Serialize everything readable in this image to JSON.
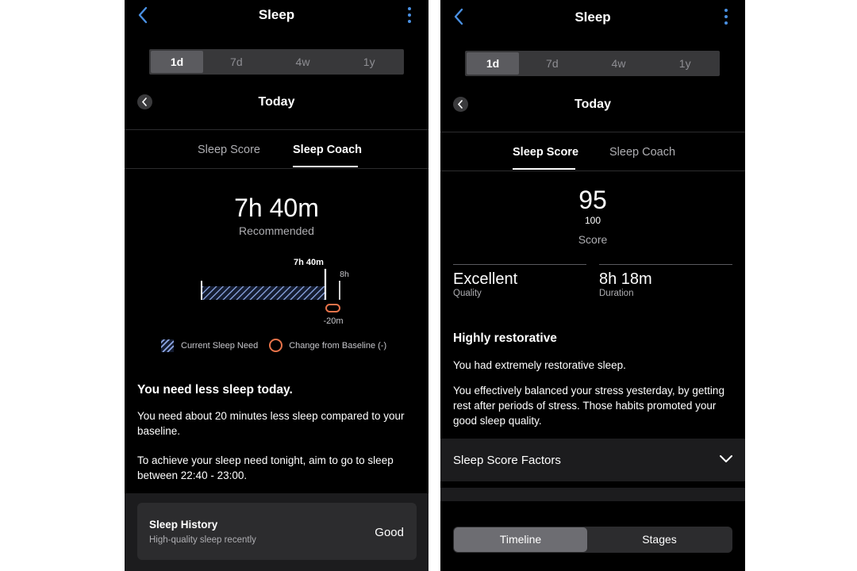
{
  "left": {
    "title": "Sleep",
    "ranges": [
      "1d",
      "7d",
      "4w",
      "1y"
    ],
    "date": "Today",
    "tabs": [
      "Sleep Score",
      "Sleep Coach"
    ],
    "recommended_value": "7h 40m",
    "recommended_label": "Recommended",
    "bar": {
      "need_label": "7h 40m",
      "baseline_label": "8h",
      "change_label": "-20m",
      "need_minutes": 460,
      "baseline_minutes": 480
    },
    "legend": {
      "need": "Current Sleep Need",
      "change": "Change from Baseline (-)"
    },
    "headline": "You need less sleep today.",
    "para1": "You need about 20 minutes less sleep compared to your baseline.",
    "para2": "To achieve your sleep need tonight, aim to go to sleep between 22:40 - 23:00.",
    "history": {
      "title": "Sleep History",
      "subtitle": "High-quality sleep recently",
      "value": "Good"
    }
  },
  "right": {
    "title": "Sleep",
    "ranges": [
      "1d",
      "7d",
      "4w",
      "1y"
    ],
    "date": "Today",
    "tabs": [
      "Sleep Score",
      "Sleep Coach"
    ],
    "score": "95",
    "score_max": "100",
    "score_label": "Score",
    "quality_value": "Excellent",
    "quality_label": "Quality",
    "duration_value": "8h 18m",
    "duration_label": "Duration",
    "headline": "Highly restorative",
    "para1": "You had extremely restorative sleep.",
    "para2": "You effectively balanced your stress yesterday, by getting rest after periods of stress. Those habits promoted your good sleep quality.",
    "factors_label": "Sleep Score Factors",
    "segments": [
      "Timeline",
      "Stages"
    ]
  },
  "colors": {
    "accent_blue": "#4a90e2",
    "hatch_blue": "#8fa9e6",
    "change_orange": "#e8734a"
  }
}
